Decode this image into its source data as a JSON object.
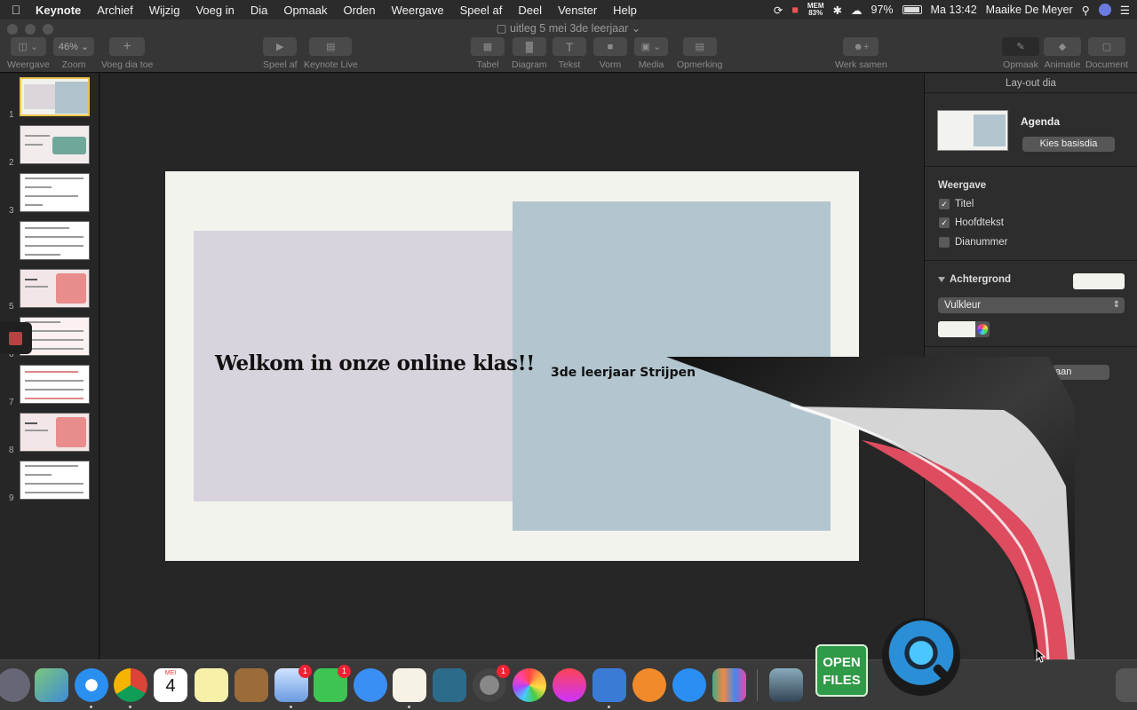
{
  "menubar": {
    "app": "Keynote",
    "menus": [
      "Archief",
      "Wijzig",
      "Voeg in",
      "Dia",
      "Opmaak",
      "Orden",
      "Weergave",
      "Speel af",
      "Deel",
      "Venster",
      "Help"
    ],
    "mem_label": "MEM",
    "mem_value": "83%",
    "battery": "97%",
    "clock": "Ma 13:42",
    "user": "Maaike De Meyer"
  },
  "window": {
    "title": "uitleg 5 mei 3de leerjaar"
  },
  "toolbar": {
    "view": "Weergave",
    "zoom_value": "46%",
    "zoom": "Zoom",
    "add_slide": "Voeg dia toe",
    "play": "Speel af",
    "keynote_live": "Keynote Live",
    "table": "Tabel",
    "chart": "Diagram",
    "text": "Tekst",
    "shape": "Vorm",
    "media": "Media",
    "comment": "Opmerking",
    "collaborate": "Werk samen",
    "format": "Opmaak",
    "animate": "Animatie",
    "document": "Document"
  },
  "navigator": {
    "slides": [
      "1",
      "2",
      "3",
      "5",
      "6",
      "7",
      "8",
      "9"
    ]
  },
  "slide": {
    "title": "Welkom in onze online klas!!",
    "subtitle": "3de leerjaar Strijpen",
    "background_color": "#f3f3ee"
  },
  "inspector": {
    "header": "Lay-out dia",
    "layout_name": "Agenda",
    "change_master": "Kies basisdia",
    "appearance_heading": "Weergave",
    "checks": [
      {
        "label": "Titel",
        "checked": true
      },
      {
        "label": "Hoofdtekst",
        "checked": true
      },
      {
        "label": "Dianummer",
        "checked": false
      }
    ],
    "background_heading": "Achtergrond",
    "fill_type": "Vulkleur",
    "partial_button": "aan"
  },
  "dock": {
    "calendar_month": "MEI",
    "calendar_day": "4",
    "badges": [
      "1",
      "1",
      "1"
    ],
    "open_files": "OPEN FILES"
  }
}
